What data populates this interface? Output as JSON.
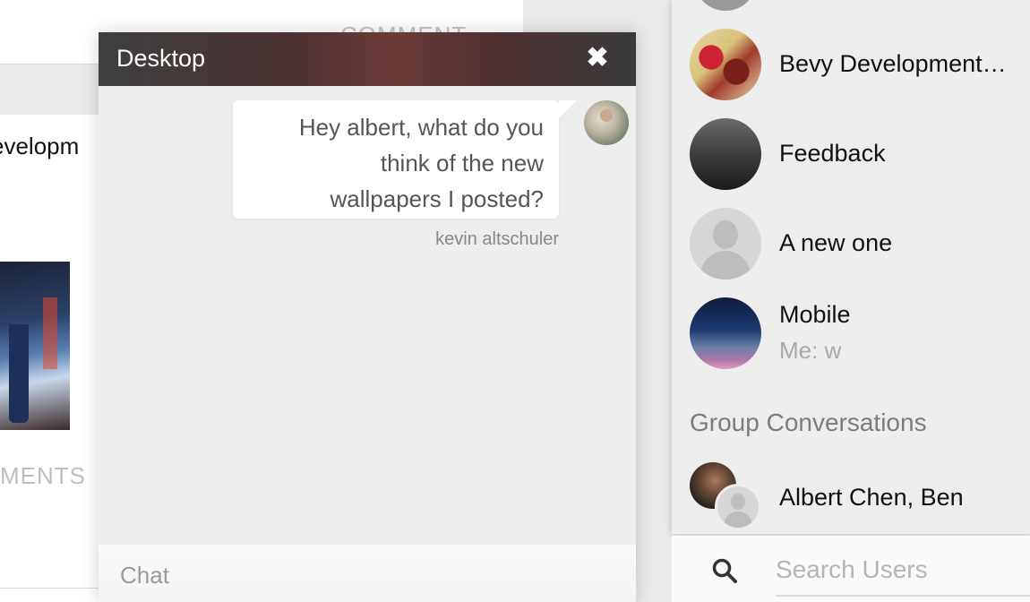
{
  "background": {
    "comment_top": "COMMENT",
    "card_title_partial": "evelopm",
    "comments_partial": "MENTS"
  },
  "chat": {
    "title": "Desktop",
    "close_symbol": "✖",
    "messages": [
      {
        "lines": [
          "Hey albert, what do you",
          "think of the new",
          "wallpapers I posted?"
        ],
        "sender": "kevin altschuler"
      }
    ],
    "input_placeholder": "Chat"
  },
  "conversations": [
    {
      "name": "Bevy Development…",
      "preview": ""
    },
    {
      "name": "Feedback",
      "preview": ""
    },
    {
      "name": "A new one",
      "preview": ""
    },
    {
      "name": "Mobile",
      "preview": "Me: w"
    }
  ],
  "group_conversations": {
    "heading": "Group Conversations",
    "items": [
      {
        "name": "Albert Chen, Ben"
      }
    ]
  },
  "search": {
    "placeholder": "Search Users",
    "icon": "search-icon"
  }
}
